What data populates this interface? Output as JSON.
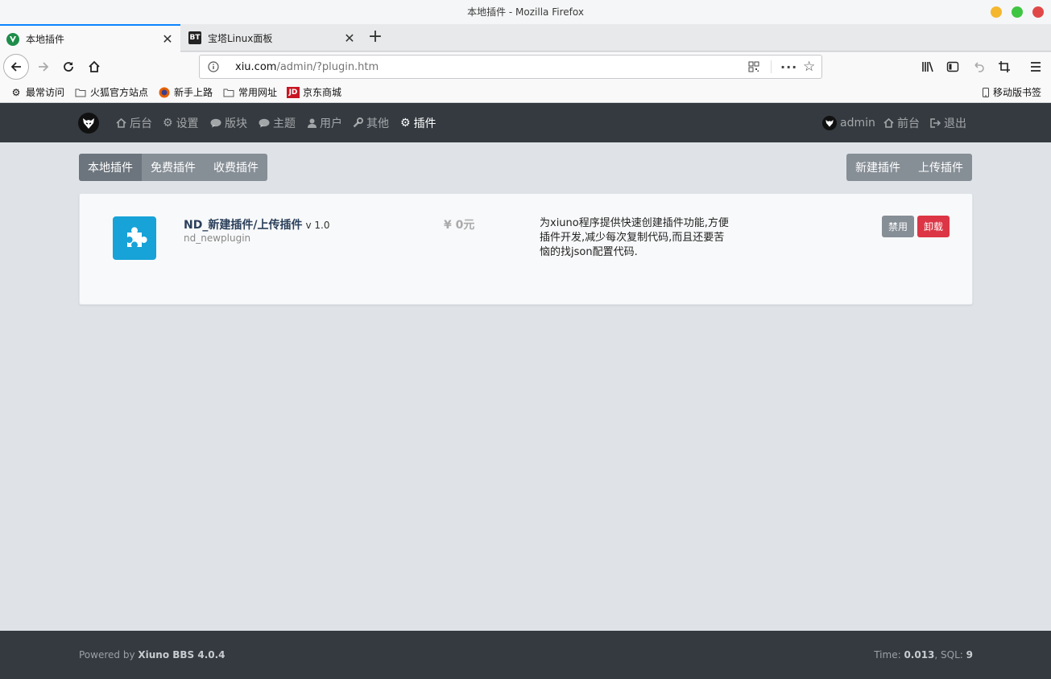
{
  "browser": {
    "window_title": "本地插件 - Mozilla Firefox",
    "tabs": [
      {
        "label": "本地插件",
        "active": true
      },
      {
        "label": "宝塔Linux面板",
        "active": false,
        "favicon_text": "BT"
      }
    ],
    "url": {
      "host": "xiu.com",
      "path": "/admin/?plugin.htm"
    },
    "bookmarks": [
      "最常访问",
      "火狐官方站点",
      "新手上路",
      "常用网址",
      "京东商城"
    ],
    "jd_icon_text": "JD",
    "mobile_bookmarks": "移动版书签"
  },
  "site": {
    "nav": [
      "后台",
      "设置",
      "版块",
      "主题",
      "用户",
      "其他",
      "插件"
    ],
    "active_nav": "插件",
    "user": "admin",
    "front": "前台",
    "logout": "退出"
  },
  "filters": [
    "本地插件",
    "免费插件",
    "收费插件"
  ],
  "actions": [
    "新建插件",
    "上传插件"
  ],
  "plugin": {
    "name": "ND_新建插件/上传插件",
    "version": "v 1.0",
    "dir": "nd_newplugin",
    "price": "¥  0元",
    "description": "为xiuno程序提供快速创建插件功能,方便插件开发,减少每次复制代码,而且还要苦恼的找json配置代码.",
    "disable_label": "禁用",
    "uninstall_label": "卸载"
  },
  "footer": {
    "powered_prefix": "Powered by ",
    "powered_name": "Xiuno BBS 4.0.4",
    "time_label": "Time: ",
    "time_value": "0.013",
    "sql_label": ", SQL: ",
    "sql_value": "9"
  },
  "colors": {
    "accent": "#0a84ff",
    "header": "#343a40",
    "danger": "#dc3545",
    "plugin_icon": "#17a2d8"
  }
}
